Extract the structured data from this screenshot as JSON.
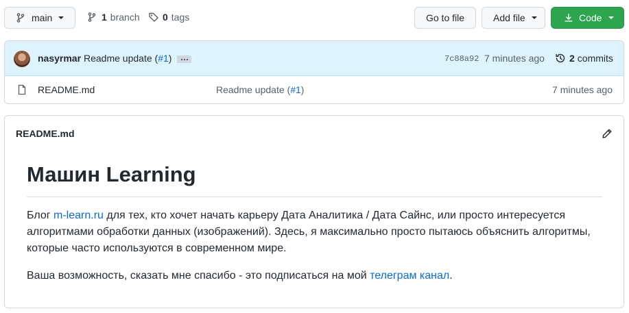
{
  "toolbar": {
    "branch": "main",
    "branches_count": "1",
    "branches_label": "branch",
    "tags_count": "0",
    "tags_label": "tags",
    "go_to_file": "Go to file",
    "add_file": "Add file",
    "code": "Code",
    "code_color": "#2da44e"
  },
  "latest_commit": {
    "author": "nasyrmar",
    "message": "Readme update (",
    "pr": "#1",
    "message_end": ")",
    "sha": "7c88a92",
    "age": "7 minutes ago",
    "commits_count": "2",
    "commits_label": "commits"
  },
  "files": [
    {
      "name": "README.md",
      "icon": "file-icon",
      "commit_message": "Readme update (",
      "commit_pr": "#1",
      "commit_end": ")",
      "age": "7 minutes ago"
    }
  ],
  "readme": {
    "header": "README.md",
    "title": "Машин Learning",
    "p1_before": "Блог ",
    "p1_link": "m-learn.ru",
    "p1_after": " для тех, кто хочет начать карьеру Дата Аналитика / Дата Сайнс, или просто интересуется алгоритмами обработки данных (изображений). Здесь, я максимально просто пытаюсь объяснить алгоритмы, которые часто используются в современном мире.",
    "p2_before": "Ваша возможность, сказать мне спасибо - это подписаться на мой ",
    "p2_link": "телеграм канал",
    "p2_after": "."
  }
}
